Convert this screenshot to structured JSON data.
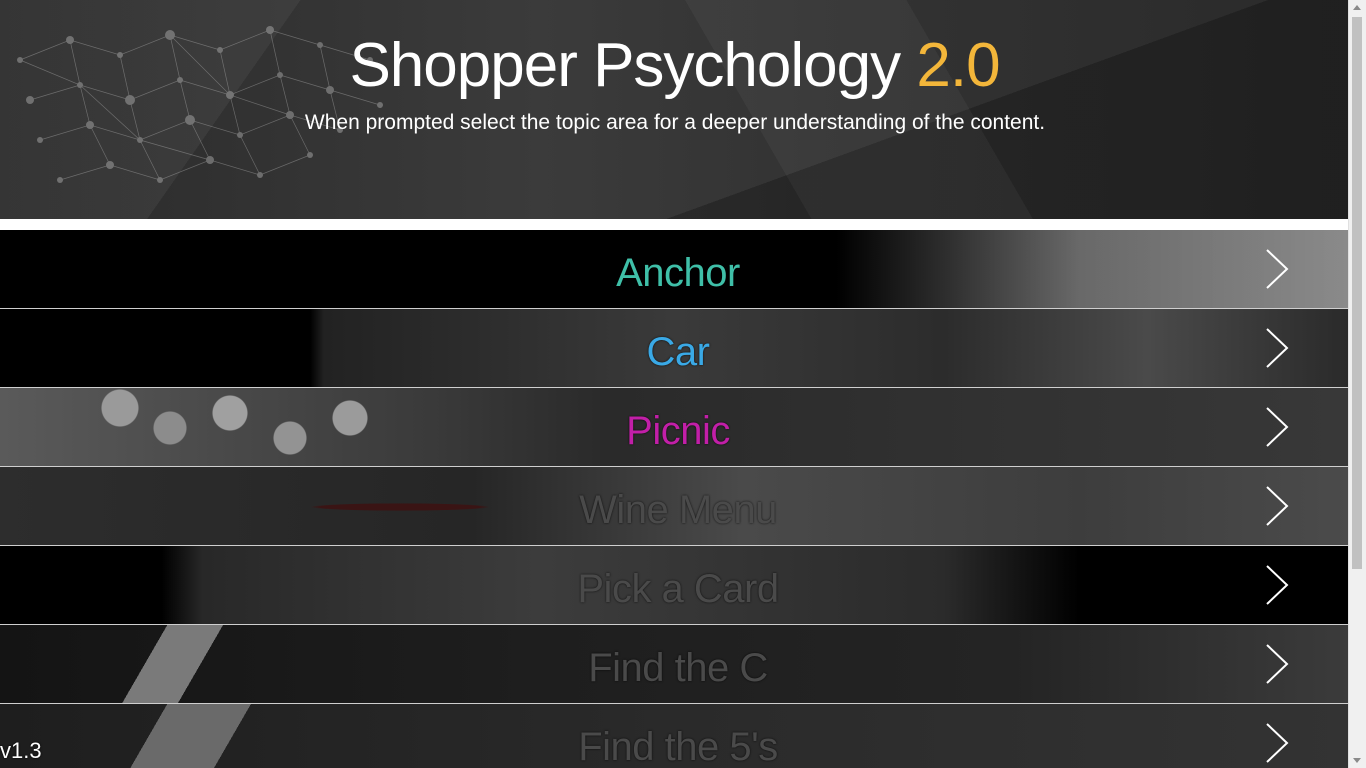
{
  "header": {
    "title": "Shopper Psychology",
    "version_number": "2.0",
    "subtitle": "When prompted select the topic area for a deeper understanding of the content."
  },
  "menu": {
    "items": [
      {
        "label": "Anchor",
        "color": "#3fbfa8"
      },
      {
        "label": "Car",
        "color": "#3aa9e6"
      },
      {
        "label": "Picnic",
        "color": "#c21fa8"
      },
      {
        "label": "Wine Menu",
        "color": "#4a4a4a"
      },
      {
        "label": "Pick a Card",
        "color": "#4a4a4a"
      },
      {
        "label": "Find the C",
        "color": "#4a4a4a"
      },
      {
        "label": "Find the 5's",
        "color": "#4a4a4a"
      }
    ]
  },
  "footer": {
    "app_version": "v1.3"
  },
  "colors": {
    "accent": "#f3b63a"
  }
}
